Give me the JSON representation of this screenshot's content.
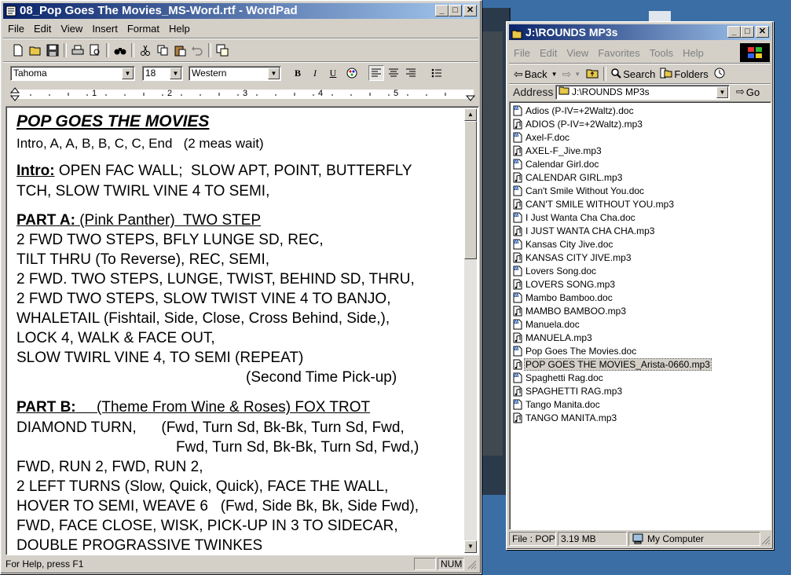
{
  "wordpad": {
    "title": "08_Pop Goes The Movies_MS-Word.rtf - WordPad",
    "menu": [
      "File",
      "Edit",
      "View",
      "Insert",
      "Format",
      "Help"
    ],
    "font_name": "Tahoma",
    "font_size": "18",
    "script": "Western",
    "ruler_numbers": [
      "1",
      "2",
      "3",
      "4",
      "5"
    ],
    "doc_lines": [
      "POP GOES THE MOVIES",
      "Intro, A, A, B, B, C, C, End   (2 meas wait)",
      "",
      "Intro: OPEN FAC WALL;  SLOW APT, POINT, BUTTERFLY",
      "TCH, SLOW TWIRL VINE 4 TO SEMI,",
      "",
      "PART A: (Pink Panther)  TWO STEP",
      "2 FWD TWO STEPS, BFLY LUNGE SD, REC,",
      "TILT THRU (To Reverse), REC, SEMI,",
      "2 FWD. TWO STEPS, LUNGE, TWIST, BEHIND SD, THRU,",
      "2 FWD TWO STEPS, SLOW TWIST VINE 4 TO BANJO,",
      "WHALETAIL (Fishtail, Side, Close, Cross Behind, Side,),",
      "LOCK 4, WALK & FACE OUT,",
      "SLOW TWIRL VINE 4, TO SEMI (REPEAT)",
      "(Second Time Pick-up)",
      "",
      "PART B:     (Theme From Wine & Roses) FOX TROT",
      "DIAMOND TURN,      (Fwd, Turn Sd, Bk-Bk, Turn Sd, Fwd,",
      "Fwd, Turn Sd, Bk-Bk, Turn Sd, Fwd,)",
      "FWD, RUN 2, FWD, RUN 2,",
      "2 LEFT TURNS (Slow, Quick, Quick), FACE THE WALL,",
      "HOVER TO SEMI, WEAVE 6   (Fwd, Side Bk, Bk, Side Fwd),",
      "FWD, FACE CLOSE, WISK, PICK-UP IN 3 TO SIDECAR,",
      "DOUBLE PROGRASSIVE TWINKES"
    ],
    "status_text": "For Help, press F1",
    "status_num": "NUM"
  },
  "explorer": {
    "title": "J:\\ROUNDS MP3s",
    "menu": [
      "File",
      "Edit",
      "View",
      "Favorites",
      "Tools",
      "Help"
    ],
    "back_label": "Back",
    "search_label": "Search",
    "folders_label": "Folders",
    "address_label": "Address",
    "address_value": "J:\\ROUNDS MP3s",
    "go_label": "Go",
    "files": [
      {
        "name": "Adios (P-IV=+2Waltz).doc",
        "type": "doc"
      },
      {
        "name": "ADIOS (P-IV=+2Waltz).mp3",
        "type": "mp3"
      },
      {
        "name": "Axel-F.doc",
        "type": "doc"
      },
      {
        "name": "AXEL-F_Jive.mp3",
        "type": "mp3"
      },
      {
        "name": "Calendar Girl.doc",
        "type": "doc"
      },
      {
        "name": "CALENDAR GIRL.mp3",
        "type": "mp3"
      },
      {
        "name": "Can't Smile Without You.doc",
        "type": "doc"
      },
      {
        "name": "CAN'T SMILE WITHOUT YOU.mp3",
        "type": "mp3"
      },
      {
        "name": "I Just Wanta Cha Cha.doc",
        "type": "doc"
      },
      {
        "name": "I JUST WANTA CHA CHA.mp3",
        "type": "mp3"
      },
      {
        "name": "Kansas City Jive.doc",
        "type": "doc"
      },
      {
        "name": "KANSAS CITY JIVE.mp3",
        "type": "mp3"
      },
      {
        "name": "Lovers Song.doc",
        "type": "doc"
      },
      {
        "name": "LOVERS SONG.mp3",
        "type": "mp3"
      },
      {
        "name": "Mambo Bamboo.doc",
        "type": "doc"
      },
      {
        "name": "MAMBO BAMBOO.mp3",
        "type": "mp3"
      },
      {
        "name": "Manuela.doc",
        "type": "doc"
      },
      {
        "name": "MANUELA.mp3",
        "type": "mp3"
      },
      {
        "name": "Pop Goes The Movies.doc",
        "type": "doc"
      },
      {
        "name": "POP GOES THE MOVIES_Arista-0660.mp3",
        "type": "mp3",
        "selected": true
      },
      {
        "name": "Spaghetti Rag.doc",
        "type": "doc"
      },
      {
        "name": "SPAGHETTI RAG.mp3",
        "type": "mp3"
      },
      {
        "name": "Tango Manita.doc",
        "type": "doc"
      },
      {
        "name": "TANGO MANITA.mp3",
        "type": "mp3"
      }
    ],
    "status_file": "File : POP",
    "status_size": "3.19 MB",
    "status_location": "My Computer"
  },
  "colors": {
    "desktop": "#3a6ea5",
    "titlebar_active": "#0a246a",
    "window_face": "#d4d0c8"
  }
}
